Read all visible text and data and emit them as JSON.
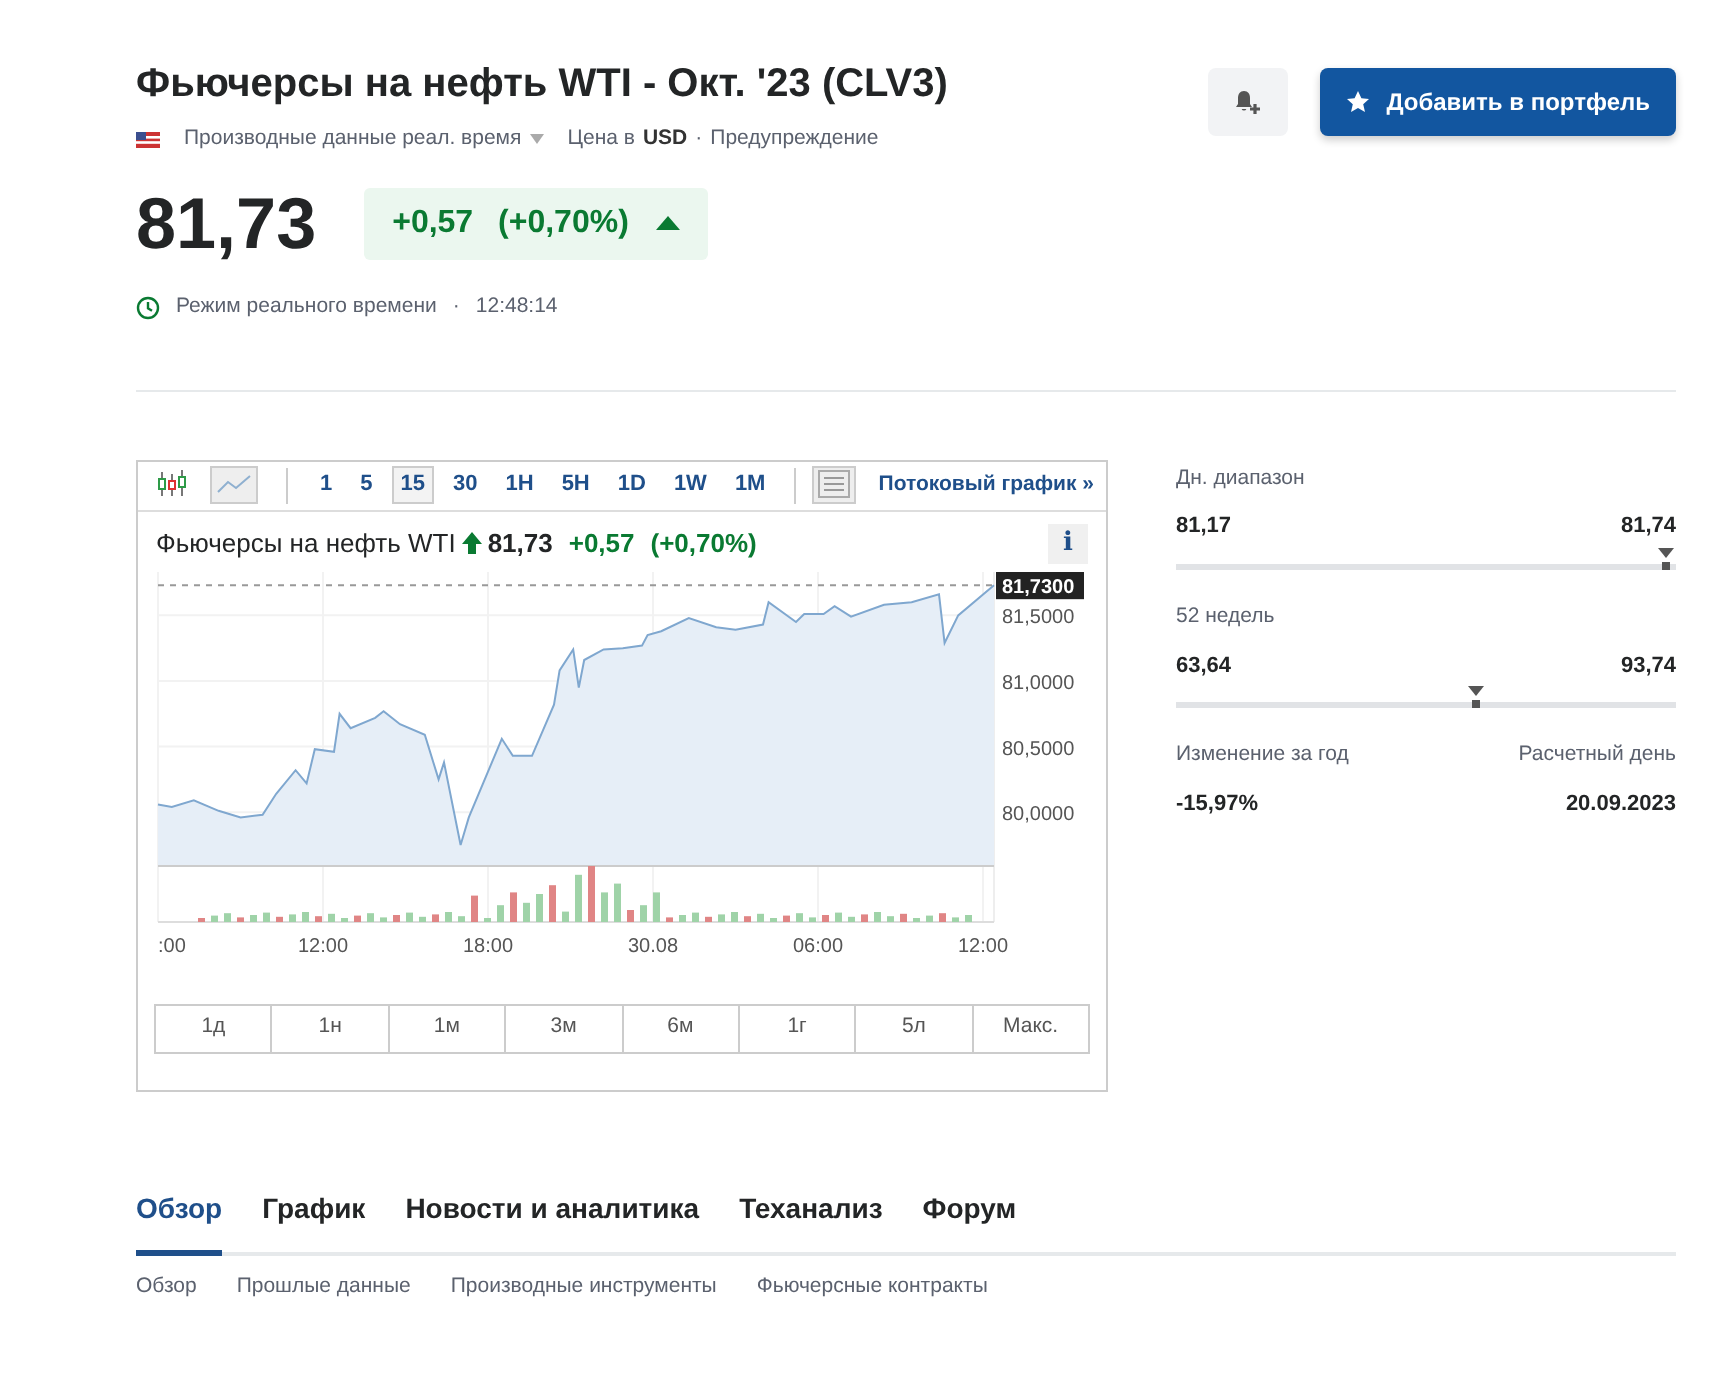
{
  "header": {
    "title": "Фьючерсы на нефть WTI - Окт. '23 (CLV3)",
    "source": "Производные данные реал. время",
    "currency_prefix": "Цена в",
    "currency": "USD",
    "separator": "·",
    "warning": "Предупреждение",
    "portfolio_button": "Добавить в портфель"
  },
  "quote": {
    "price": "81,73",
    "change": "+0,57",
    "change_pct": "(+0,70%)",
    "mode": "Режим реального времени",
    "separator": "·",
    "time": "12:48:14"
  },
  "chart_widget": {
    "chart_types": [
      {
        "kind": "candles"
      },
      {
        "kind": "line"
      }
    ],
    "intervals": [
      {
        "label": "1",
        "selected": false
      },
      {
        "label": "5",
        "selected": false
      },
      {
        "label": "15",
        "selected": true
      },
      {
        "label": "30",
        "selected": false
      },
      {
        "label": "1H",
        "selected": false
      },
      {
        "label": "5H",
        "selected": false
      },
      {
        "label": "1D",
        "selected": false
      },
      {
        "label": "1W",
        "selected": false
      },
      {
        "label": "1M",
        "selected": false
      }
    ],
    "stream_link": "Потоковый график »",
    "info_button": "i",
    "legend": {
      "name": "Фьючерсы на нефть WTI",
      "price": "81,73",
      "change": "+0,57",
      "change_pct": "(+0,70%)"
    },
    "chart": {
      "price_tag": "81,7300",
      "y_labels": [
        "81,5000",
        "81,0000",
        "80,5000",
        "80,0000"
      ],
      "x_labels": [
        ":00",
        "12:00",
        "18:00",
        "30.08",
        "06:00",
        "12:00"
      ]
    },
    "periods": [
      "1д",
      "1н",
      "1м",
      "3м",
      "6м",
      "1г",
      "5л",
      "Макс."
    ]
  },
  "stats": {
    "ranges": [
      {
        "label": "Дн. диапазон",
        "low": "81,17",
        "high": "81,74",
        "level": 0.98
      },
      {
        "label": "52 недель",
        "low": "63,64",
        "high": "93,74",
        "level": 0.6
      }
    ],
    "year_change": {
      "label": "Изменение за год",
      "value": "-15,97%"
    },
    "settlement": {
      "label": "Расчетный день",
      "value": "20.09.2023"
    }
  },
  "tabs": [
    {
      "label": "Обзор",
      "selected": true
    },
    {
      "label": "График",
      "selected": false
    },
    {
      "label": "Новости и аналитика",
      "selected": false
    },
    {
      "label": "Теханализ",
      "selected": false
    },
    {
      "label": "Форум",
      "selected": false
    }
  ],
  "subtabs": [
    {
      "label": "Обзор",
      "selected": false
    },
    {
      "label": "Прошлые данные",
      "selected": false
    },
    {
      "label": "Производные инструменты",
      "selected": false
    },
    {
      "label": "Фьючерсные контракты",
      "selected": false
    }
  ]
}
